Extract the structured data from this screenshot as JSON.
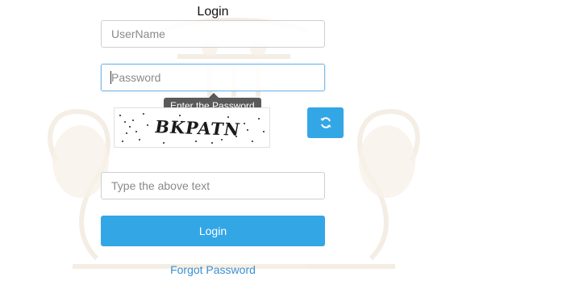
{
  "login_form": {
    "title": "Login",
    "username": {
      "value": "",
      "placeholder": "UserName"
    },
    "password": {
      "value": "",
      "placeholder": "Password",
      "tooltip": "Enter the Password"
    },
    "captcha": {
      "image_text": "BKPATN",
      "refresh_icon": "refresh-icon"
    },
    "captcha_input": {
      "value": "",
      "placeholder": "Type the above text"
    },
    "login_button": "Login",
    "forgot_password_link": "Forgot Password"
  },
  "colors": {
    "primary": "#33a6e6",
    "link": "#3b8fd1",
    "tooltip_bg": "#5a5a5a",
    "focus_border": "#7ab8e8"
  }
}
